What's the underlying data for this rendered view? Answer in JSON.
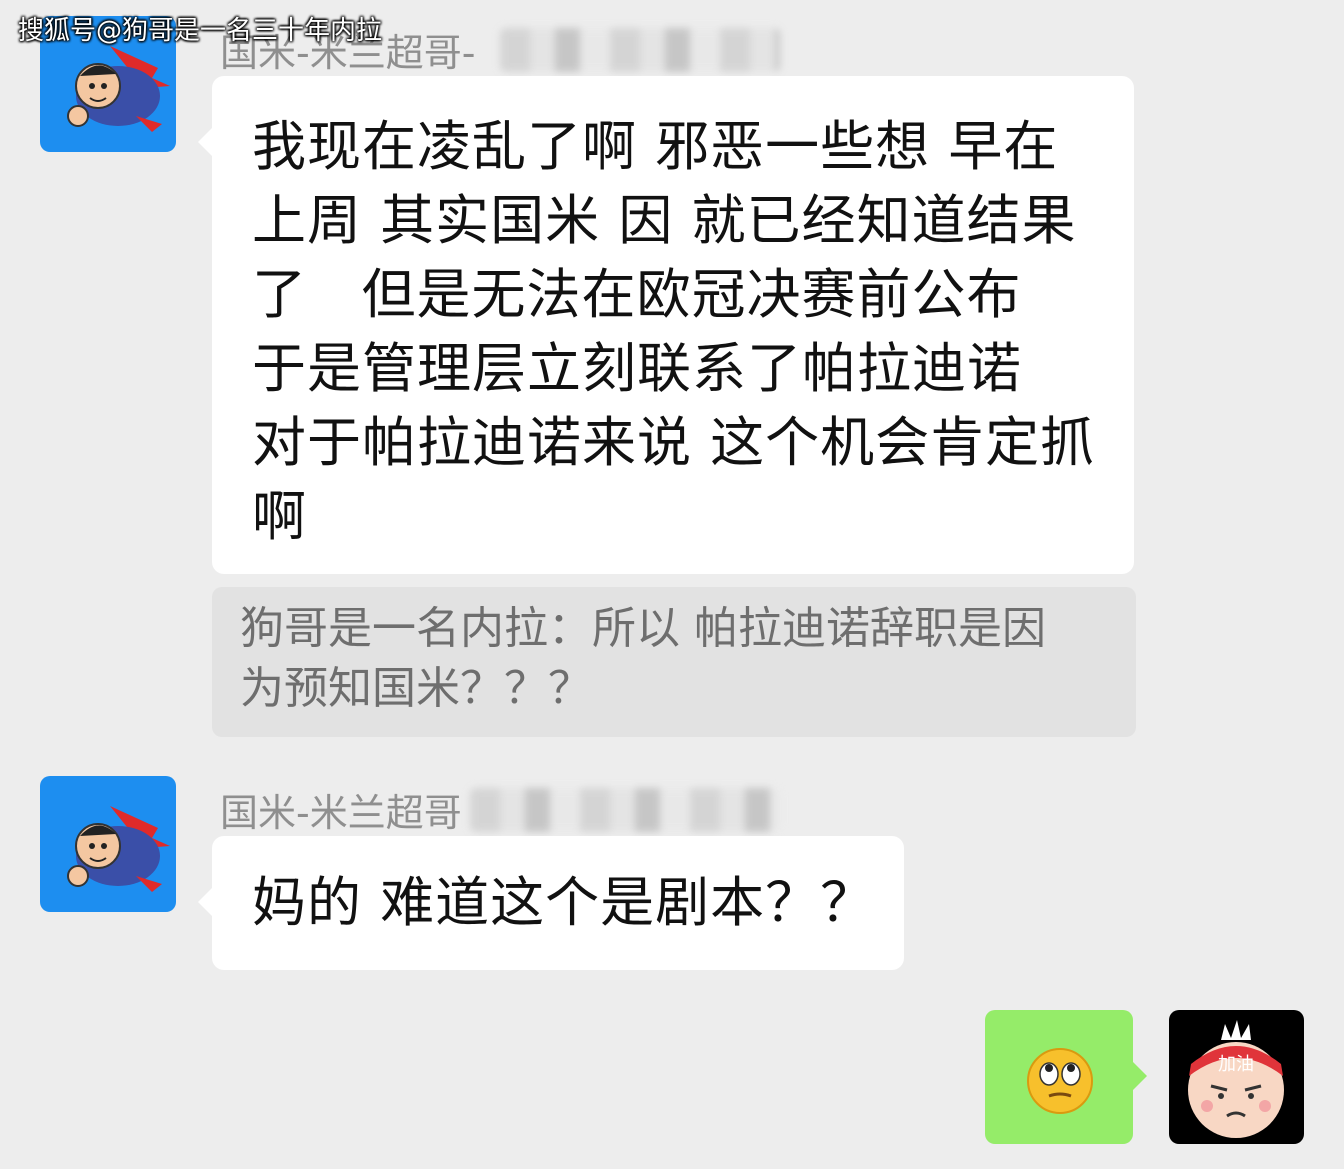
{
  "watermark": "搜狐号@狗哥是一名三十年内拉",
  "messages": [
    {
      "sender": "国米-米兰超哥-",
      "lines": [
        "我现在凌乱了啊 邪恶一些想 早在",
        "上周 其实国米 因 就已经知道结果",
        "了   但是无法在欧冠决赛前公布",
        "于是管理层立刻联系了帕拉迪诺",
        "对于帕拉迪诺来说 这个机会肯定抓",
        "啊"
      ],
      "quote_lines": [
        "狗哥是一名内拉：所以 帕拉迪诺辞职是因",
        "为预知国米？？？"
      ]
    },
    {
      "sender": "国米-米兰超哥",
      "lines": [
        "妈的 难道这个是剧本？？"
      ]
    }
  ],
  "my_message": {
    "content": "eye-roll-emoji"
  },
  "my_avatar": {
    "badge_text": "加油"
  },
  "colors": {
    "background": "#ededed",
    "incoming_bubble": "#ffffff",
    "outgoing_bubble": "#95ec69",
    "quote_bg": "#e2e2e2",
    "avatar_blue": "#1d8ef0"
  }
}
